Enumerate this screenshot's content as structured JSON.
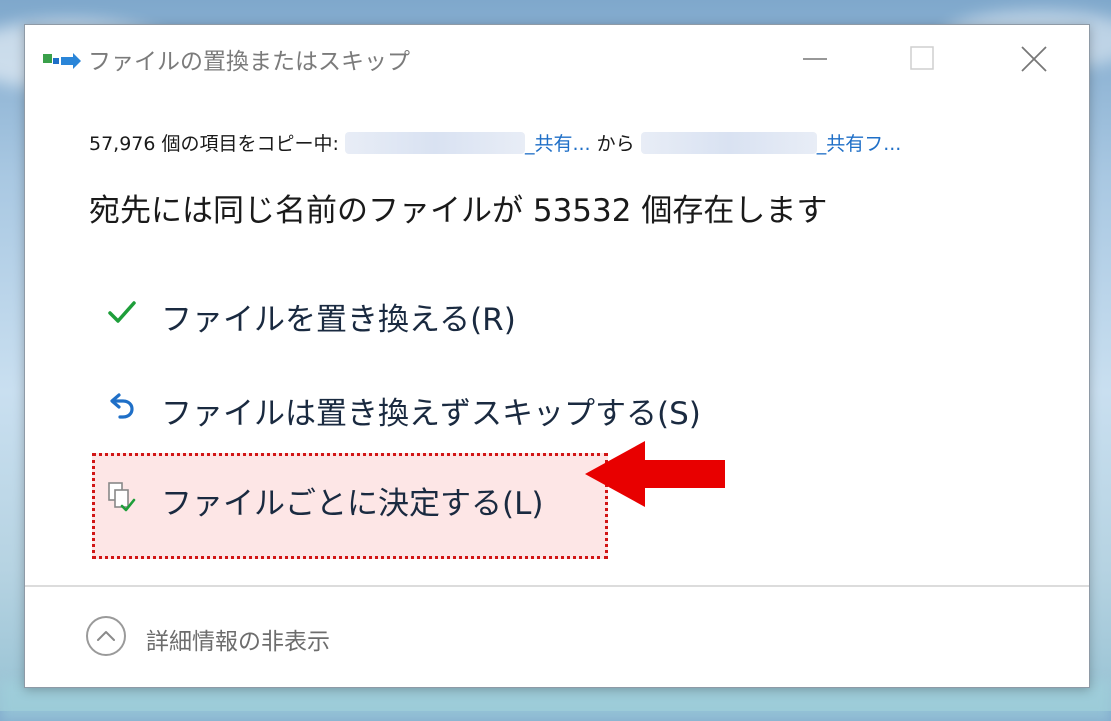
{
  "dialog": {
    "title": "ファイルの置換またはスキップ",
    "copy_prefix": "57,976 個の項目をコピー中: ",
    "source_link": "_共有...",
    "from_word": " から ",
    "dest_link": "_共有フ...",
    "headline": "宛先には同じ名前のファイルが 53532 個存在します"
  },
  "options": [
    {
      "label": "ファイルを置き換える(R)",
      "icon": "checkmark-icon"
    },
    {
      "label": "ファイルは置き換えずスキップする(S)",
      "icon": "undo-arrow-icon"
    },
    {
      "label": "ファイルごとに決定する(L)",
      "icon": "compare-files-icon"
    }
  ],
  "footer": {
    "details_label": "詳細情報の非表示",
    "icon": "chevron-up-icon"
  },
  "colors": {
    "highlight_border": "#d11515",
    "highlight_fill": "#fde6e6",
    "arrow": "#e80000",
    "link": "#1f6fc7",
    "check": "#1e9e3a"
  }
}
